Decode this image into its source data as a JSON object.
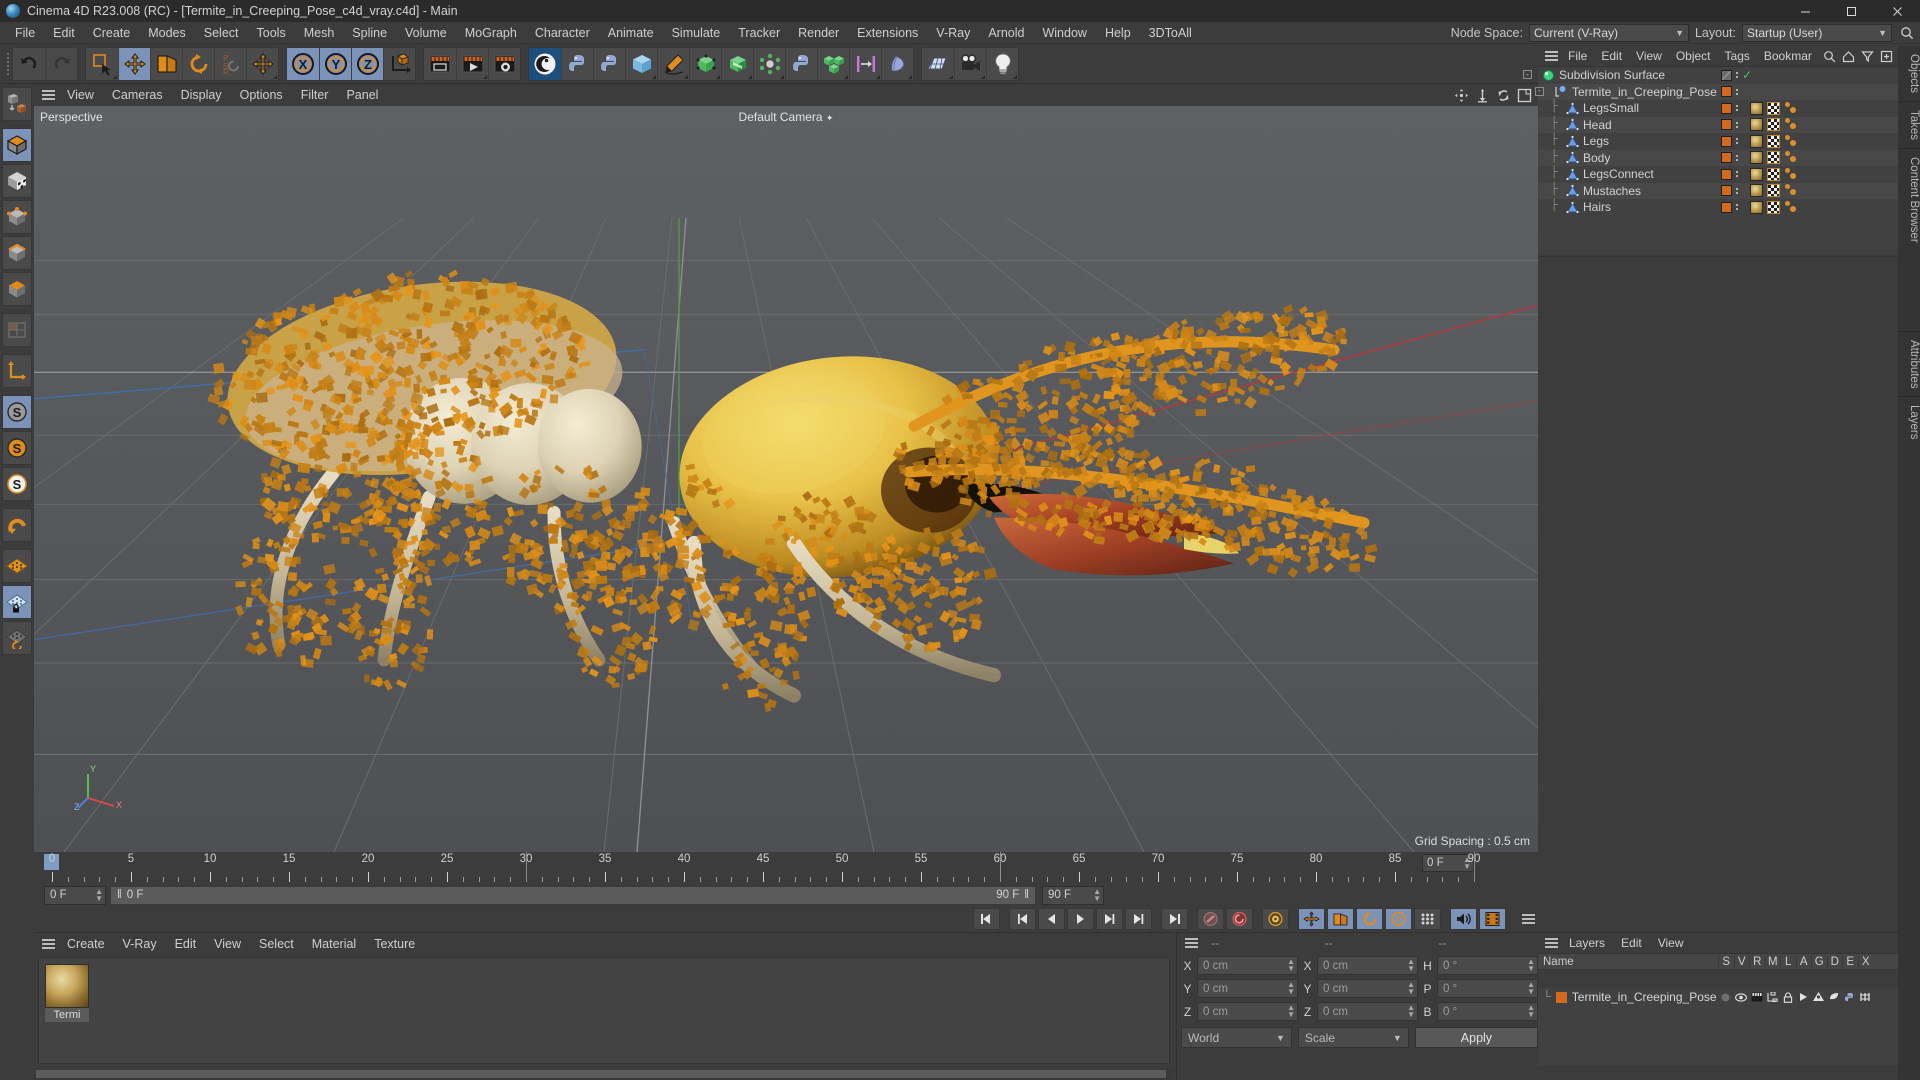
{
  "window": {
    "title": "Cinema 4D R23.008 (RC) - [Termite_in_Creeping_Pose_c4d_vray.c4d] - Main",
    "logo_icon": "cinema4d-logo-icon",
    "minimize_label": "–",
    "maximize_label": "❑",
    "close_label": "✕"
  },
  "menubar": {
    "items": [
      "File",
      "Edit",
      "Create",
      "Modes",
      "Select",
      "Tools",
      "Mesh",
      "Spline",
      "Volume",
      "MoGraph",
      "Character",
      "Animate",
      "Simulate",
      "Tracker",
      "Render",
      "Extensions",
      "V-Ray",
      "Arnold",
      "Window",
      "Help",
      "3DToAll"
    ],
    "node_space_label": "Node Space:",
    "node_space_value": "Current (V-Ray)",
    "layout_label": "Layout:",
    "layout_value": "Startup (User)",
    "search_icon": "search-icon"
  },
  "toolbar": {
    "groups": [
      {
        "name": "history",
        "buttons": [
          {
            "name": "undo-button",
            "icon": "undo-icon",
            "active": false,
            "corner": false
          },
          {
            "name": "redo-button",
            "icon": "redo-icon",
            "active": false,
            "corner": false
          }
        ]
      },
      {
        "name": "selection-tools",
        "buttons": [
          {
            "name": "live-selection-tool",
            "icon": "live-selection-icon",
            "active": false,
            "corner": true
          },
          {
            "name": "move-tool",
            "icon": "move-icon",
            "active": true,
            "corner": false
          },
          {
            "name": "scale-tool",
            "icon": "scale-icon",
            "active": false,
            "corner": false
          },
          {
            "name": "rotate-tool",
            "icon": "rotate-icon",
            "active": false,
            "corner": false
          },
          {
            "name": "psr-lock-tool",
            "icon": "psr-icon",
            "active": false,
            "corner": false
          },
          {
            "name": "world-object-axis-tool",
            "icon": "axis-move-icon",
            "active": false,
            "corner": true
          }
        ]
      },
      {
        "name": "axis-locks",
        "buttons": [
          {
            "name": "lock-x-axis-button",
            "icon": "x-axis-icon",
            "active": true,
            "corner": false
          },
          {
            "name": "lock-y-axis-button",
            "icon": "y-axis-icon",
            "active": true,
            "corner": false
          },
          {
            "name": "lock-z-axis-button",
            "icon": "z-axis-icon",
            "active": true,
            "corner": false
          },
          {
            "name": "world-coordinate-system-button",
            "icon": "world-axis-icon",
            "active": false,
            "corner": false
          }
        ]
      },
      {
        "name": "render-group",
        "buttons": [
          {
            "name": "render-view-button",
            "icon": "render-view-icon",
            "active": false,
            "corner": false
          },
          {
            "name": "render-to-picture-viewer-button",
            "icon": "render-picture-icon",
            "active": false,
            "corner": true
          },
          {
            "name": "render-settings-button",
            "icon": "render-settings-icon",
            "active": false,
            "corner": false
          }
        ]
      },
      {
        "name": "plugins-group",
        "buttons": [
          {
            "name": "cinema4d-splash-button",
            "icon": "c4d-logo-icon",
            "active": true,
            "corner": false
          },
          {
            "name": "python-script-button",
            "icon": "python-icon",
            "active": false,
            "corner": false
          },
          {
            "name": "python-generator-button",
            "icon": "python-generator-icon",
            "active": false,
            "corner": false
          },
          {
            "name": "add-cube-button",
            "icon": "cube-blue-icon",
            "active": false,
            "corner": true
          },
          {
            "name": "add-spline-pen-button",
            "icon": "pen-icon",
            "active": false,
            "corner": true
          },
          {
            "name": "nurbs-generator-button",
            "icon": "nurbs-icon",
            "active": false,
            "corner": true
          },
          {
            "name": "array-generator-button",
            "icon": "array-green-icon",
            "active": false,
            "corner": true
          },
          {
            "name": "deformer-button",
            "icon": "deformer-icon",
            "active": false,
            "corner": true
          },
          {
            "name": "scene-python-button",
            "icon": "python-blue-icon",
            "active": false,
            "corner": false
          },
          {
            "name": "mograph-cloner-button",
            "icon": "cloner-icon",
            "active": false,
            "corner": true
          },
          {
            "name": "align-button",
            "icon": "align-icon",
            "active": false,
            "corner": true
          },
          {
            "name": "field-button",
            "icon": "field-icon",
            "active": false,
            "corner": true
          }
        ]
      },
      {
        "name": "scene-objects",
        "buttons": [
          {
            "name": "add-floor-button",
            "icon": "floor-icon",
            "active": false,
            "corner": true
          },
          {
            "name": "add-camera-button",
            "icon": "camera-icon",
            "active": false,
            "corner": true
          },
          {
            "name": "add-light-button",
            "icon": "light-bulb-icon",
            "active": false,
            "corner": true
          }
        ]
      }
    ]
  },
  "left_toolbar": {
    "buttons": [
      {
        "name": "make-editable-button",
        "icon": "make-editable-icon",
        "active": false,
        "corner": true
      },
      {
        "name": "model-mode-button",
        "icon": "model-mode-icon",
        "active": true,
        "corner": true
      },
      {
        "name": "texture-mode-button",
        "icon": "texture-mode-icon",
        "active": false,
        "corner": false
      },
      {
        "name": "points-mode-button",
        "icon": "points-mode-icon",
        "active": false,
        "corner": false
      },
      {
        "name": "edges-mode-button",
        "icon": "edges-mode-icon",
        "active": false,
        "corner": false
      },
      {
        "name": "polygons-mode-button",
        "icon": "polygons-mode-icon",
        "active": false,
        "corner": false
      },
      {
        "name": "uv-mode-button",
        "icon": "uv-mode-icon",
        "active": false,
        "corner": false
      },
      {
        "name": "axis-mode-button",
        "icon": "axis-mode-icon",
        "active": false,
        "corner": false
      },
      {
        "name": "enable-axis-button",
        "icon": "s-grey-icon",
        "active": true,
        "corner": false
      },
      {
        "name": "object-axis-button",
        "icon": "s-orange-icon",
        "active": false,
        "corner": true
      },
      {
        "name": "viewport-solo-button",
        "icon": "s-white-icon",
        "active": false,
        "corner": false
      },
      {
        "name": "snap-button",
        "icon": "magnet-icon",
        "active": false,
        "corner": true
      },
      {
        "name": "workplane-button",
        "icon": "workplane-icon",
        "active": false,
        "corner": false
      },
      {
        "name": "lock-workplane-button",
        "icon": "workplane-lock-icon",
        "active": true,
        "corner": true
      },
      {
        "name": "planar-workplane-button",
        "icon": "workplane-rotate-icon",
        "active": false,
        "corner": false
      }
    ]
  },
  "viewport": {
    "menu": [
      "View",
      "Cameras",
      "Display",
      "Options",
      "Filter",
      "Panel"
    ],
    "hamburger_icon": "hamburger-icon",
    "corner_icons": [
      "viewport-move-icon",
      "viewport-pan-icon",
      "viewport-rotate-icon",
      "viewport-maximize-icon"
    ],
    "label": "Perspective",
    "camera_label": "Default Camera",
    "grid_spacing": "Grid Spacing : 0.5 cm",
    "axis_labels": {
      "x": "X",
      "y": "Y",
      "z": "Z"
    },
    "scene_description": "Termite in creeping pose - orange and cream 3D insect model"
  },
  "timeline": {
    "ticks": [
      {
        "value": "0",
        "frame": 0
      },
      {
        "value": "5",
        "frame": 5
      },
      {
        "value": "10",
        "frame": 10
      },
      {
        "value": "15",
        "frame": 15
      },
      {
        "value": "20",
        "frame": 20
      },
      {
        "value": "25",
        "frame": 25
      },
      {
        "value": "30",
        "frame": 30
      },
      {
        "value": "35",
        "frame": 35
      },
      {
        "value": "40",
        "frame": 40
      },
      {
        "value": "45",
        "frame": 45
      },
      {
        "value": "50",
        "frame": 50
      },
      {
        "value": "55",
        "frame": 55
      },
      {
        "value": "60",
        "frame": 60
      },
      {
        "value": "65",
        "frame": 65
      },
      {
        "value": "70",
        "frame": 70
      },
      {
        "value": "75",
        "frame": 75
      },
      {
        "value": "80",
        "frame": 80
      },
      {
        "value": "85",
        "frame": 85
      },
      {
        "value": "90",
        "frame": 90
      }
    ],
    "range_start": 0,
    "range_end": 90,
    "current_frame_field": "0 F",
    "start_frame_field": "0 F",
    "preview_range_label": "0 F",
    "end_frame_field": "90 F",
    "preview_end_label": "90 F"
  },
  "transport": {
    "buttons": [
      {
        "name": "go-to-start-button",
        "icon": "skip-start-icon",
        "active": false
      },
      {
        "name": "previous-key-button",
        "icon": "prev-key-icon",
        "active": false
      },
      {
        "name": "step-back-button",
        "icon": "step-back-icon",
        "active": false
      },
      {
        "name": "play-button",
        "icon": "play-icon",
        "active": false
      },
      {
        "name": "step-forward-button",
        "icon": "step-forward-icon",
        "active": false
      },
      {
        "name": "next-key-button",
        "icon": "next-key-icon",
        "active": false
      },
      {
        "name": "go-to-end-button",
        "icon": "skip-end-icon",
        "active": false
      },
      {
        "name": "record-keyframe-button",
        "icon": "record-key-icon",
        "active": false
      },
      {
        "name": "autokey-button",
        "icon": "autokey-icon",
        "active": false
      },
      {
        "name": "keyframe-settings-button",
        "icon": "key-settings-icon",
        "active": false
      },
      {
        "name": "record-position-button",
        "icon": "record-position-icon",
        "active": true
      },
      {
        "name": "record-scale-button",
        "icon": "record-scale-icon",
        "active": true
      },
      {
        "name": "record-rotation-button",
        "icon": "record-rotation-icon",
        "active": true
      },
      {
        "name": "record-parameter-button",
        "icon": "record-param-icon",
        "active": true
      },
      {
        "name": "record-pla-button",
        "icon": "record-pla-icon",
        "active": false
      },
      {
        "name": "sound-button",
        "icon": "sound-icon",
        "active": true
      },
      {
        "name": "film-button",
        "icon": "film-icon",
        "active": true
      }
    ]
  },
  "material_manager": {
    "menu": [
      "Create",
      "V-Ray",
      "Edit",
      "View",
      "Select",
      "Material",
      "Texture"
    ],
    "hamburger_icon": "hamburger-icon",
    "materials": [
      {
        "name": "Termi",
        "thumb_icon": "material-sphere-icon",
        "selected": true
      }
    ]
  },
  "coordinates": {
    "headers": [
      "--",
      "--",
      "--"
    ],
    "hamburger_icon": "hamburger-icon",
    "rows": [
      {
        "pos_label": "X",
        "pos_value": "0 cm",
        "size_label": "X",
        "size_value": "0 cm",
        "rot_label": "H",
        "rot_value": "0 °"
      },
      {
        "pos_label": "Y",
        "pos_value": "0 cm",
        "size_label": "Y",
        "size_value": "0 cm",
        "rot_label": "P",
        "rot_value": "0 °"
      },
      {
        "pos_label": "Z",
        "pos_value": "0 cm",
        "size_label": "Z",
        "size_value": "0 cm",
        "rot_label": "B",
        "rot_value": "0 °"
      }
    ],
    "system_value": "World",
    "mode_value": "Scale",
    "apply_label": "Apply"
  },
  "object_manager": {
    "menu": [
      "File",
      "Edit",
      "View",
      "Object",
      "Tags",
      "Bookmar"
    ],
    "hamburger_icon": "hamburger-icon",
    "icons": [
      "search-icon",
      "home-icon",
      "filter-icon",
      "add-icon"
    ],
    "items": [
      {
        "name": "Subdivision Surface",
        "indent": 0,
        "icon": "subdivision-surface-icon",
        "expander": "-",
        "box": "grey",
        "check": true,
        "tags": []
      },
      {
        "name": "Termite_in_Creeping_Pose",
        "indent": 1,
        "icon": "null-object-icon",
        "expander": "-",
        "box": "orange",
        "check": false,
        "tags": []
      },
      {
        "name": "LegsSmall",
        "indent": 2,
        "icon": "polygon-object-icon",
        "expander": "",
        "box": "orange",
        "check": false,
        "tags": [
          "mat",
          "chk",
          "phong"
        ]
      },
      {
        "name": "Head",
        "indent": 2,
        "icon": "polygon-object-icon",
        "expander": "",
        "box": "orange",
        "check": false,
        "tags": [
          "mat",
          "chk",
          "phong"
        ]
      },
      {
        "name": "Legs",
        "indent": 2,
        "icon": "polygon-object-icon",
        "expander": "",
        "box": "orange",
        "check": false,
        "tags": [
          "mat",
          "chk",
          "phong"
        ]
      },
      {
        "name": "Body",
        "indent": 2,
        "icon": "polygon-object-icon",
        "expander": "",
        "box": "orange",
        "check": false,
        "tags": [
          "mat",
          "chk",
          "phong"
        ]
      },
      {
        "name": "LegsConnect",
        "indent": 2,
        "icon": "polygon-object-icon",
        "expander": "",
        "box": "orange",
        "check": false,
        "tags": [
          "mat",
          "chk",
          "phong"
        ]
      },
      {
        "name": "Mustaches",
        "indent": 2,
        "icon": "polygon-object-icon",
        "expander": "",
        "box": "orange",
        "check": false,
        "tags": [
          "mat",
          "chk",
          "phong"
        ]
      },
      {
        "name": "Hairs",
        "indent": 2,
        "icon": "polygon-object-icon",
        "expander": "",
        "box": "orange",
        "check": false,
        "tags": [
          "mat",
          "chk",
          "phong"
        ]
      }
    ]
  },
  "right_tabs": [
    "Objects",
    "Takes",
    "Content Browser"
  ],
  "right_tabs_lower": [
    "Attributes",
    "Layers"
  ],
  "layer_manager": {
    "menu": [
      "Layers",
      "Edit",
      "View"
    ],
    "hamburger_icon": "hamburger-icon",
    "columns": [
      "Name",
      "S",
      "V",
      "R",
      "M",
      "L",
      "A",
      "G",
      "D",
      "E",
      "X"
    ],
    "rows": [
      {
        "name": "Termite_in_Creeping_Pose",
        "color": "#d2691e",
        "flags": [
          "solo-dot-icon",
          "eye-icon",
          "render-icon",
          "manager-icon",
          "lock-icon",
          "animation-icon",
          "generator-icon",
          "deformer-icon",
          "expression-icon",
          "xref-icon"
        ]
      }
    ]
  },
  "colors": {
    "accent_orange": "#d2691e",
    "accent_blue": "#7b93b8",
    "panel_bg": "#3c3c3c",
    "list_bg": "#414141",
    "viewport_bg": "#555759",
    "green_check": "#49c15a"
  }
}
